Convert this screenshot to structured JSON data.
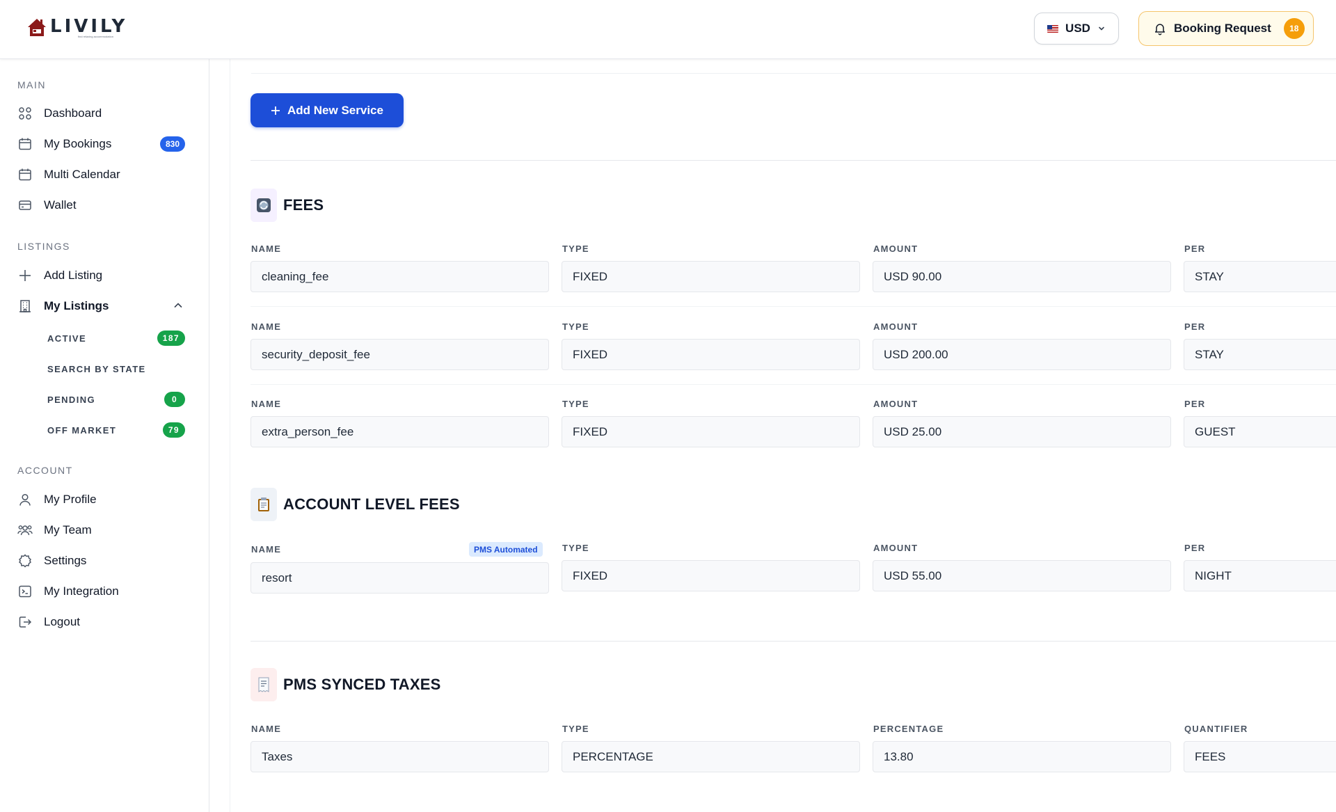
{
  "header": {
    "logo_text": "LIVILY",
    "logo_tagline": "find relaxing accommodation",
    "currency": "USD",
    "booking_label": "Booking Request",
    "booking_count": "18"
  },
  "sidebar": {
    "main_title": "MAIN",
    "dashboard": "Dashboard",
    "my_bookings": "My Bookings",
    "my_bookings_count": "830",
    "multi_calendar": "Multi Calendar",
    "wallet": "Wallet",
    "listings_title": "LISTINGS",
    "add_listing": "Add Listing",
    "my_listings": "My Listings",
    "active": "ACTIVE",
    "active_count": "187",
    "search_by_state": "SEARCH BY STATE",
    "pending": "PENDING",
    "pending_count": "0",
    "off_market": "OFF MARKET",
    "off_market_count": "79",
    "account_title": "ACCOUNT",
    "my_profile": "My Profile",
    "my_team": "My Team",
    "settings": "Settings",
    "my_integration": "My Integration",
    "logout": "Logout"
  },
  "main": {
    "add_service": "Add New Service",
    "fees_title": "FEES",
    "fees": [
      {
        "name": "cleaning_fee",
        "type": "FIXED",
        "amount": "USD 90.00",
        "per": "STAY"
      },
      {
        "name": "security_deposit_fee",
        "type": "FIXED",
        "amount": "USD 200.00",
        "per": "STAY"
      },
      {
        "name": "extra_person_fee",
        "type": "FIXED",
        "amount": "USD 25.00",
        "per": "GUEST"
      }
    ],
    "labels": {
      "name": "NAME",
      "type": "TYPE",
      "amount": "AMOUNT",
      "per": "PER",
      "percentage": "PERCENTAGE",
      "quantifier": "QUANTIFIER"
    },
    "account_fees_title": "ACCOUNT LEVEL FEES",
    "pms_badge": "PMS Automated",
    "account_fee": {
      "name": "resort",
      "type": "FIXED",
      "amount": "USD 55.00",
      "per": "NIGHT"
    },
    "taxes_title": "PMS SYNCED TAXES",
    "tax": {
      "name": "Taxes",
      "type": "PERCENTAGE",
      "percentage": "13.80",
      "quantifier": "FEES"
    }
  },
  "colors": {
    "primary": "#1d4ed8",
    "badge_blue": "#2563eb",
    "badge_green": "#16a34a",
    "booking_bg": "#fffbeb",
    "booking_badge": "#f59e0b"
  }
}
